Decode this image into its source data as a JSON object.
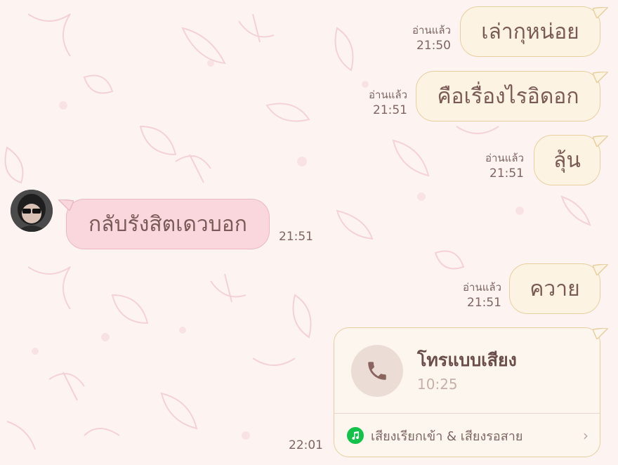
{
  "chat": {
    "messages_out": [
      {
        "text": "เล่ากุหน่อย",
        "read": "อ่านแล้ว",
        "time": "21:50"
      },
      {
        "text": "คือเรื่องไรอิดอก",
        "read": "อ่านแล้ว",
        "time": "21:51"
      },
      {
        "text": "ลุ้น",
        "read": "อ่านแล้ว",
        "time": "21:51"
      },
      {
        "text": "ควาย",
        "read": "อ่านแล้ว",
        "time": "21:51"
      }
    ],
    "message_in": {
      "text": "กลับรังสิตเดวบอก",
      "time": "21:51"
    },
    "call": {
      "title": "โทรแบบเสียง",
      "duration": "10:25",
      "footer": "เสียงเรียกเข้า & เสียงรอสาย",
      "chevron": "›",
      "time": "22:01"
    }
  },
  "colors": {
    "background": "#fdf4f2",
    "bubble_out": "#fdf3e2",
    "bubble_in": "#f9d7dc",
    "badge_green": "#12c24b"
  },
  "icons": {
    "call": "phone-icon",
    "music": "music-note-icon",
    "chevron": "chevron-right-icon"
  }
}
